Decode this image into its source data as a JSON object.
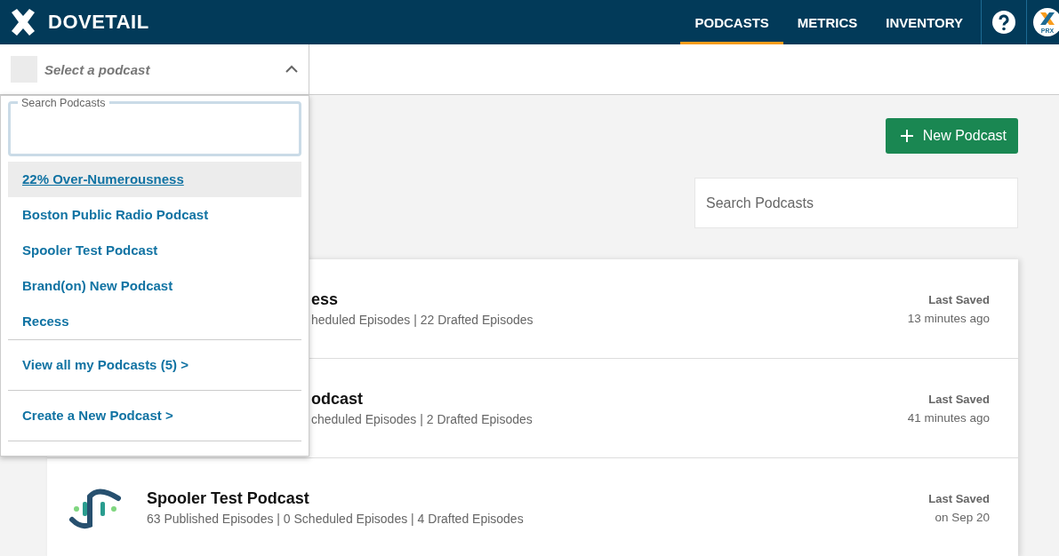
{
  "header": {
    "logo_text": "DOVETAIL",
    "nav": [
      {
        "label": "PODCASTS",
        "selected": true
      },
      {
        "label": "METRICS",
        "selected": false
      },
      {
        "label": "INVENTORY",
        "selected": false
      }
    ],
    "avatar_label": "PRX"
  },
  "podcast_select": {
    "placeholder": "Select a podcast",
    "expanded": true
  },
  "dropdown": {
    "search_label": "Search Podcasts",
    "items": [
      {
        "label": "22% Over-Numerousness",
        "highlighted": true
      },
      {
        "label": "Boston Public Radio Podcast",
        "highlighted": false
      },
      {
        "label": "Spooler Test Podcast",
        "highlighted": false
      },
      {
        "label": "Brand(on) New Podcast",
        "highlighted": false
      },
      {
        "label": "Recess",
        "highlighted": false
      }
    ],
    "links": [
      "View all my Podcasts (5) >",
      "Create a New Podcast >"
    ]
  },
  "new_button": "New Podcast",
  "search": {
    "placeholder": "Search Podcasts"
  },
  "podcasts": [
    {
      "kind": "covered",
      "title": "ess",
      "stats": "heduled Episodes | 22 Drafted Episodes",
      "saved_label": "Last Saved",
      "saved_time": "13 minutes ago"
    },
    {
      "kind": "covered",
      "title": "odcast",
      "stats": "cheduled Episodes | 2 Drafted Episodes",
      "saved_label": "Last Saved",
      "saved_time": "41 minutes ago"
    },
    {
      "kind": "full",
      "title": "Spooler Test Podcast",
      "stats": "63 Published Episodes | 0 Scheduled Episodes | 4 Drafted Episodes",
      "saved_label": "Last Saved",
      "saved_time": "on Sep 20"
    }
  ]
}
